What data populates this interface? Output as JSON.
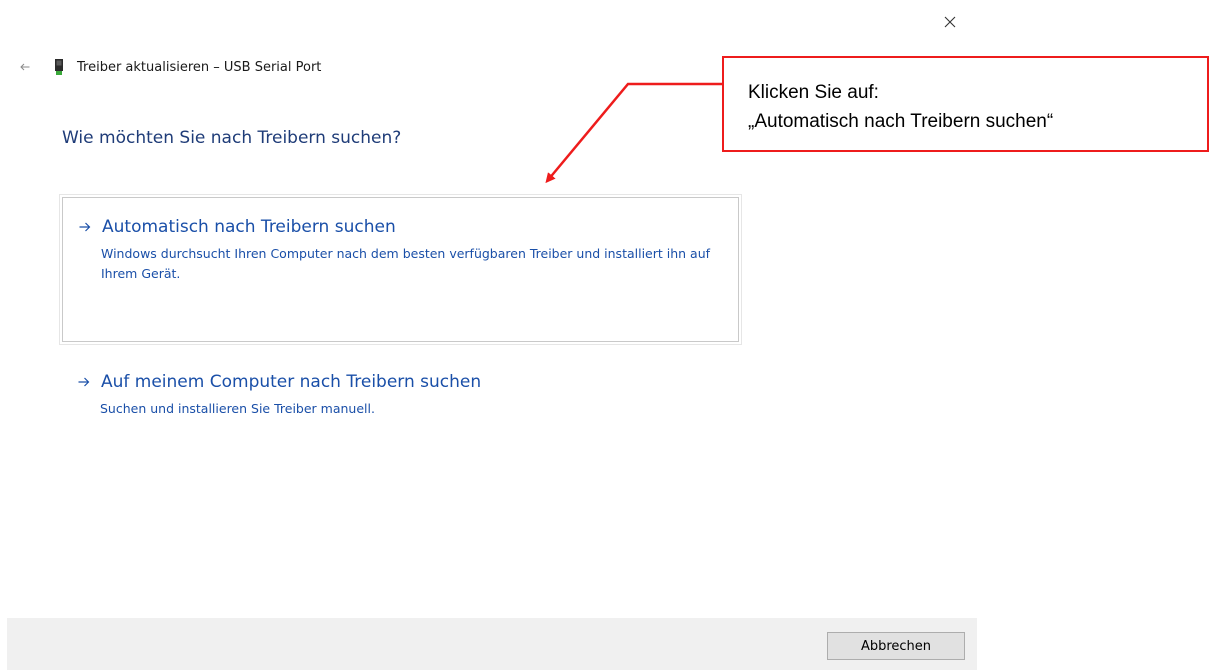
{
  "window": {
    "title": "Treiber aktualisieren – USB Serial Port"
  },
  "dialog": {
    "heading": "Wie möchten Sie nach Treibern suchen?",
    "options": [
      {
        "title": "Automatisch nach Treibern suchen",
        "description": "Windows durchsucht Ihren Computer nach dem besten verfügbaren Treiber und installiert ihn auf Ihrem Gerät."
      },
      {
        "title": "Auf meinem Computer nach Treibern suchen",
        "description": "Suchen und installieren Sie Treiber manuell."
      }
    ]
  },
  "footer": {
    "cancel_label": "Abbrechen"
  },
  "annotation": {
    "line1": "Klicken Sie auf:",
    "line2": "„Automatisch nach Treibern suchen“"
  },
  "colors": {
    "link": "#1a4fa8",
    "heading": "#1f3c78",
    "annotation_border": "#ee1c1c",
    "footer_bg": "#f0f0f0"
  },
  "icons": {
    "close": "close-icon",
    "back": "back-arrow-icon",
    "device": "usb-device-icon",
    "option_arrow": "arrow-right-icon"
  }
}
